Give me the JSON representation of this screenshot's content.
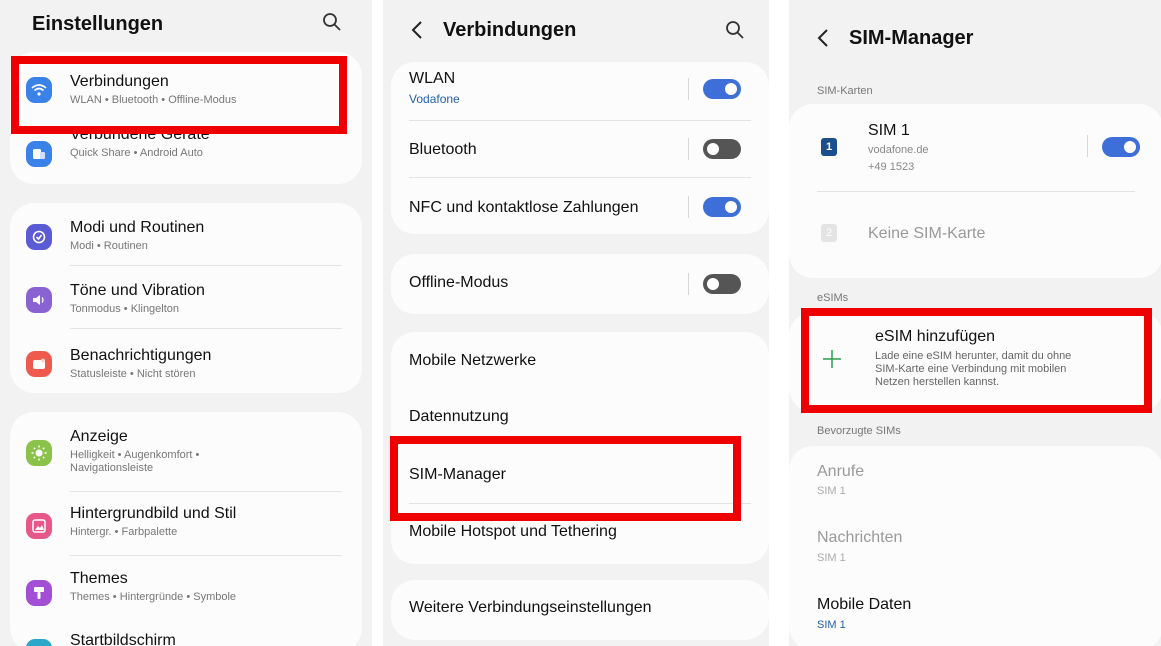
{
  "panel1": {
    "title": "Einstellungen",
    "search_icon": "search-icon",
    "items": [
      {
        "label": "Verbindungen",
        "sub": "WLAN • Bluetooth • Offline-Modus",
        "icon": "wifi-icon",
        "color": "#3b82e8"
      },
      {
        "label": "Verbundene Geräte",
        "sub": "Quick Share • Android Auto",
        "icon": "devices-icon",
        "color": "#3b82e8"
      },
      {
        "label": "Modi und Routinen",
        "sub": "Modi • Routinen",
        "icon": "check-circle-icon",
        "color": "#5b5bd6"
      },
      {
        "label": "Töne und Vibration",
        "sub": "Tonmodus • Klingelton",
        "icon": "speaker-icon",
        "color": "#8a63d2"
      },
      {
        "label": "Benachrichtigungen",
        "sub": "Statusleiste • Nicht stören",
        "icon": "bell-icon",
        "color": "#ef5a4f"
      },
      {
        "label": "Anzeige",
        "sub": "Helligkeit • Augenkomfort •",
        "sub2": "Navigationsleiste",
        "icon": "sun-icon",
        "color": "#8bc34a"
      },
      {
        "label": "Hintergrundbild und Stil",
        "sub": "Hintergr. • Farbpalette",
        "icon": "image-icon",
        "color": "#e8578a"
      },
      {
        "label": "Themes",
        "sub": "Themes • Hintergründe • Symbole",
        "icon": "brush-icon",
        "color": "#a24fd6"
      },
      {
        "label": "Startbildschirm",
        "icon": "home-icon",
        "color": "#2aa7c9"
      }
    ]
  },
  "panel2": {
    "title": "Verbindungen",
    "back_icon": "back-icon",
    "search_icon": "search-icon",
    "wlan": {
      "label": "WLAN",
      "sub": "Vodafone",
      "state": "on"
    },
    "bluetooth": {
      "label": "Bluetooth",
      "state": "off"
    },
    "nfc": {
      "label": "NFC und kontaktlose Zahlungen",
      "state": "on"
    },
    "offline": {
      "label": "Offline-Modus",
      "state": "off"
    },
    "mobile_networks": "Mobile Netzwerke",
    "data_usage": "Datennutzung",
    "sim_manager": "SIM-Manager",
    "hotspot": "Mobile Hotspot und Tethering",
    "more": "Weitere Verbindungseinstellungen"
  },
  "panel3": {
    "title": "SIM-Manager",
    "back_icon": "back-icon",
    "sim_section": "SIM-Karten",
    "sim1": {
      "label": "SIM 1",
      "carrier": "vodafone.de",
      "number": "+49 1523",
      "badge": "1",
      "state": "on"
    },
    "sim2": {
      "label": "Keine SIM-Karte",
      "badge": "2"
    },
    "esim_section": "eSIMs",
    "esim": {
      "label": "eSIM hinzufügen",
      "line1": "Lade eine eSIM herunter, damit du ohne",
      "line2": "SIM-Karte eine Verbindung mit mobilen",
      "line3": "Netzen herstellen kannst."
    },
    "pref_section": "Bevorzugte SIMs",
    "calls": {
      "label": "Anrufe",
      "sub": "SIM 1"
    },
    "messages": {
      "label": "Nachrichten",
      "sub": "SIM 1"
    },
    "mobile_data": {
      "label": "Mobile Daten",
      "sub": "SIM 1"
    }
  },
  "colors": {
    "highlight": "#ee0000",
    "toggle_on": "#3e6fd8",
    "accent_green": "#2e9d4a"
  }
}
